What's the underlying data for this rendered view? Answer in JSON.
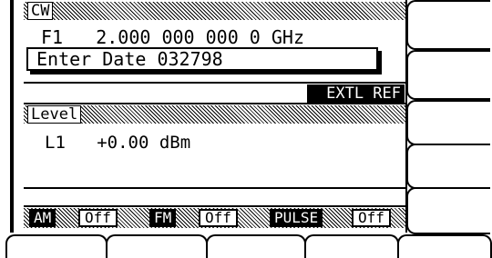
{
  "cw": {
    "header_label": "CW",
    "frequency_line": "F1   2.000 000 000 0 GHz",
    "entry_prompt": "Enter Date 032798",
    "status_flag": "EXTL REF"
  },
  "level": {
    "header_label": "Level",
    "line": "L1   +0.00 dBm"
  },
  "modulation": [
    {
      "label": "AM",
      "state": "Off"
    },
    {
      "label": "FM",
      "state": "Off"
    },
    {
      "label": "PULSE",
      "state": "Off"
    }
  ],
  "softkeys": {
    "right_count": 5,
    "bottom_count": 5
  }
}
